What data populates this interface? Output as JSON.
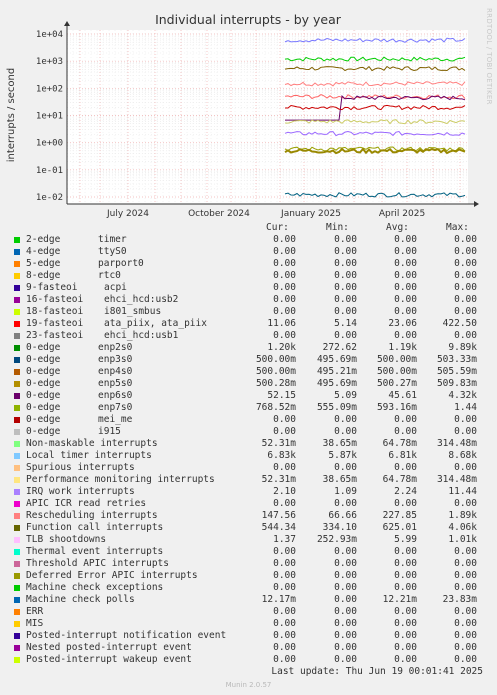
{
  "chart_data": {
    "type": "line",
    "title": "Individual interrupts - by year",
    "ylabel": "interrupts / second",
    "yscale": "log",
    "ylim": [
      0.01,
      10000
    ],
    "yticks": [
      "1e-02",
      "1e-01",
      "1e+00",
      "1e+01",
      "1e+02",
      "1e+03",
      "1e+04"
    ],
    "xticks": [
      "July 2024",
      "October 2024",
      "January 2025",
      "April 2025"
    ],
    "grid": true,
    "watermark": "RRDTOOL / TOBI OETIKER",
    "series": [
      {
        "name": "0-edge enp2s0",
        "color": "#00cc00",
        "approx_level": 1200
      },
      {
        "name": "Function call interrupts",
        "color": "#806000",
        "approx_level": 544
      },
      {
        "name": "Rescheduling interrupts",
        "color": "#ff7f7f",
        "approx_level": 150
      },
      {
        "name": "Non-maskable / Performance monitoring interrupts",
        "color": "#ff6666",
        "approx_level": 50
      },
      {
        "name": "0-edge enp6s0",
        "color": "#660066",
        "approx_level": 45
      },
      {
        "name": "19-fasteoi ata_piix, ata_piix",
        "color": "#cc0000",
        "approx_level": 20
      },
      {
        "name": "Local timer interrupts",
        "color": "#7777ff",
        "approx_level": 6000
      },
      {
        "name": "Machine check polls",
        "color": "#006080",
        "approx_level": 0.0122
      },
      {
        "name": "IRQ work interrupts",
        "color": "#9966ff",
        "approx_level": 2.2
      },
      {
        "name": "0-edge enp7s0",
        "color": "#99a000",
        "approx_level": 0.59
      },
      {
        "name": "0-edge enp3s0 / enp4s0 / enp5s0",
        "color": "#998800",
        "approx_level": 0.5
      },
      {
        "name": "TLB shootdowns",
        "color": "#cccc66",
        "approx_level": 6
      }
    ]
  },
  "legend": {
    "headers": {
      "cur": "Cur:",
      "min": "Min:",
      "avg": "Avg:",
      "max": "Max:"
    },
    "rows": [
      {
        "name": "2-edge",
        "device": "timer",
        "color": "#00cc00",
        "cur": "0.00",
        "min": "0.00",
        "avg": "0.00",
        "max": "0.00"
      },
      {
        "name": "4-edge",
        "device": "ttyS0",
        "color": "#0066b3",
        "cur": "0.00",
        "min": "0.00",
        "avg": "0.00",
        "max": "0.00"
      },
      {
        "name": "5-edge",
        "device": "parport0",
        "color": "#ff8000",
        "cur": "0.00",
        "min": "0.00",
        "avg": "0.00",
        "max": "0.00"
      },
      {
        "name": "8-edge",
        "device": "rtc0",
        "color": "#ffcc00",
        "cur": "0.00",
        "min": "0.00",
        "avg": "0.00",
        "max": "0.00"
      },
      {
        "name": "9-fasteoi",
        "device": "acpi",
        "color": "#330099",
        "cur": "0.00",
        "min": "0.00",
        "avg": "0.00",
        "max": "0.00"
      },
      {
        "name": "16-fasteoi",
        "device": "ehci_hcd:usb2",
        "color": "#990099",
        "cur": "0.00",
        "min": "0.00",
        "avg": "0.00",
        "max": "0.00"
      },
      {
        "name": "18-fasteoi",
        "device": "i801_smbus",
        "color": "#ccff00",
        "cur": "0.00",
        "min": "0.00",
        "avg": "0.00",
        "max": "0.00"
      },
      {
        "name": "19-fasteoi",
        "device": "ata_piix, ata_piix",
        "color": "#ff0000",
        "cur": "11.06",
        "min": "5.14",
        "avg": "23.06",
        "max": "422.50"
      },
      {
        "name": "23-fasteoi",
        "device": "ehci_hcd:usb1",
        "color": "#808080",
        "cur": "0.00",
        "min": "0.00",
        "avg": "0.00",
        "max": "0.00"
      },
      {
        "name": "0-edge",
        "device": "enp2s0",
        "color": "#008f00",
        "cur": "1.20k",
        "min": "272.62",
        "avg": "1.19k",
        "max": "9.89k"
      },
      {
        "name": "0-edge",
        "device": "enp3s0",
        "color": "#00487d",
        "cur": "500.00m",
        "min": "495.69m",
        "avg": "500.00m",
        "max": "503.33m"
      },
      {
        "name": "0-edge",
        "device": "enp4s0",
        "color": "#b35a00",
        "cur": "500.00m",
        "min": "495.21m",
        "avg": "500.00m",
        "max": "505.59m"
      },
      {
        "name": "0-edge",
        "device": "enp5s0",
        "color": "#b38f00",
        "cur": "500.28m",
        "min": "495.69m",
        "avg": "500.27m",
        "max": "509.83m"
      },
      {
        "name": "0-edge",
        "device": "enp6s0",
        "color": "#6b006b",
        "cur": "52.15",
        "min": "5.09",
        "avg": "45.61",
        "max": "4.32k"
      },
      {
        "name": "0-edge",
        "device": "enp7s0",
        "color": "#8fb300",
        "cur": "768.52m",
        "min": "555.09m",
        "avg": "593.16m",
        "max": "1.44"
      },
      {
        "name": "0-edge",
        "device": "mei_me",
        "color": "#b30000",
        "cur": "0.00",
        "min": "0.00",
        "avg": "0.00",
        "max": "0.00"
      },
      {
        "name": "0-edge",
        "device": "i915",
        "color": "#bebebe",
        "cur": "0.00",
        "min": "0.00",
        "avg": "0.00",
        "max": "0.00"
      },
      {
        "name": "Non-maskable interrupts",
        "device": "",
        "color": "#80ff80",
        "cur": "52.31m",
        "min": "38.65m",
        "avg": "64.78m",
        "max": "314.48m"
      },
      {
        "name": "Local timer interrupts",
        "device": "",
        "color": "#80c9ff",
        "cur": "6.83k",
        "min": "5.87k",
        "avg": "6.81k",
        "max": "8.68k"
      },
      {
        "name": "Spurious interrupts",
        "device": "",
        "color": "#ffc080",
        "cur": "0.00",
        "min": "0.00",
        "avg": "0.00",
        "max": "0.00"
      },
      {
        "name": "Performance monitoring interrupts",
        "device": "",
        "color": "#ffe680",
        "cur": "52.31m",
        "min": "38.65m",
        "avg": "64.78m",
        "max": "314.48m"
      },
      {
        "name": "IRQ work interrupts",
        "device": "",
        "color": "#aa80ff",
        "cur": "2.10",
        "min": "1.09",
        "avg": "2.24",
        "max": "11.44"
      },
      {
        "name": "APIC ICR read retries",
        "device": "",
        "color": "#ee00cc",
        "cur": "0.00",
        "min": "0.00",
        "avg": "0.00",
        "max": "0.00"
      },
      {
        "name": "Rescheduling interrupts",
        "device": "",
        "color": "#ff8080",
        "cur": "147.56",
        "min": "66.66",
        "avg": "227.85",
        "max": "1.89k"
      },
      {
        "name": "Function call interrupts",
        "device": "",
        "color": "#666600",
        "cur": "544.34",
        "min": "334.10",
        "avg": "625.01",
        "max": "4.06k"
      },
      {
        "name": "TLB shootdowns",
        "device": "",
        "color": "#ffbfff",
        "cur": "1.37",
        "min": "252.93m",
        "avg": "5.99",
        "max": "1.01k"
      },
      {
        "name": "Thermal event interrupts",
        "device": "",
        "color": "#00ffcc",
        "cur": "0.00",
        "min": "0.00",
        "avg": "0.00",
        "max": "0.00"
      },
      {
        "name": "Threshold APIC interrupts",
        "device": "",
        "color": "#cc6699",
        "cur": "0.00",
        "min": "0.00",
        "avg": "0.00",
        "max": "0.00"
      },
      {
        "name": "Deferred Error APIC interrupts",
        "device": "",
        "color": "#999900",
        "cur": "0.00",
        "min": "0.00",
        "avg": "0.00",
        "max": "0.00"
      },
      {
        "name": "Machine check exceptions",
        "device": "",
        "color": "#00cc00",
        "cur": "0.00",
        "min": "0.00",
        "avg": "0.00",
        "max": "0.00"
      },
      {
        "name": "Machine check polls",
        "device": "",
        "color": "#0066b3",
        "cur": "12.17m",
        "min": "0.00",
        "avg": "12.21m",
        "max": "23.83m"
      },
      {
        "name": "ERR",
        "device": "",
        "color": "#ff8000",
        "cur": "0.00",
        "min": "0.00",
        "avg": "0.00",
        "max": "0.00"
      },
      {
        "name": "MIS",
        "device": "",
        "color": "#ffcc00",
        "cur": "0.00",
        "min": "0.00",
        "avg": "0.00",
        "max": "0.00"
      },
      {
        "name": "Posted-interrupt notification event",
        "device": "",
        "color": "#330099",
        "cur": "0.00",
        "min": "0.00",
        "avg": "0.00",
        "max": "0.00"
      },
      {
        "name": "Nested posted-interrupt event",
        "device": "",
        "color": "#990099",
        "cur": "0.00",
        "min": "0.00",
        "avg": "0.00",
        "max": "0.00"
      },
      {
        "name": "Posted-interrupt wakeup event",
        "device": "",
        "color": "#ccff00",
        "cur": "0.00",
        "min": "0.00",
        "avg": "0.00",
        "max": "0.00"
      }
    ]
  },
  "footer": {
    "last_update": "Last update: Thu Jun 19 00:01:41 2025",
    "version": "Munin 2.0.57"
  }
}
